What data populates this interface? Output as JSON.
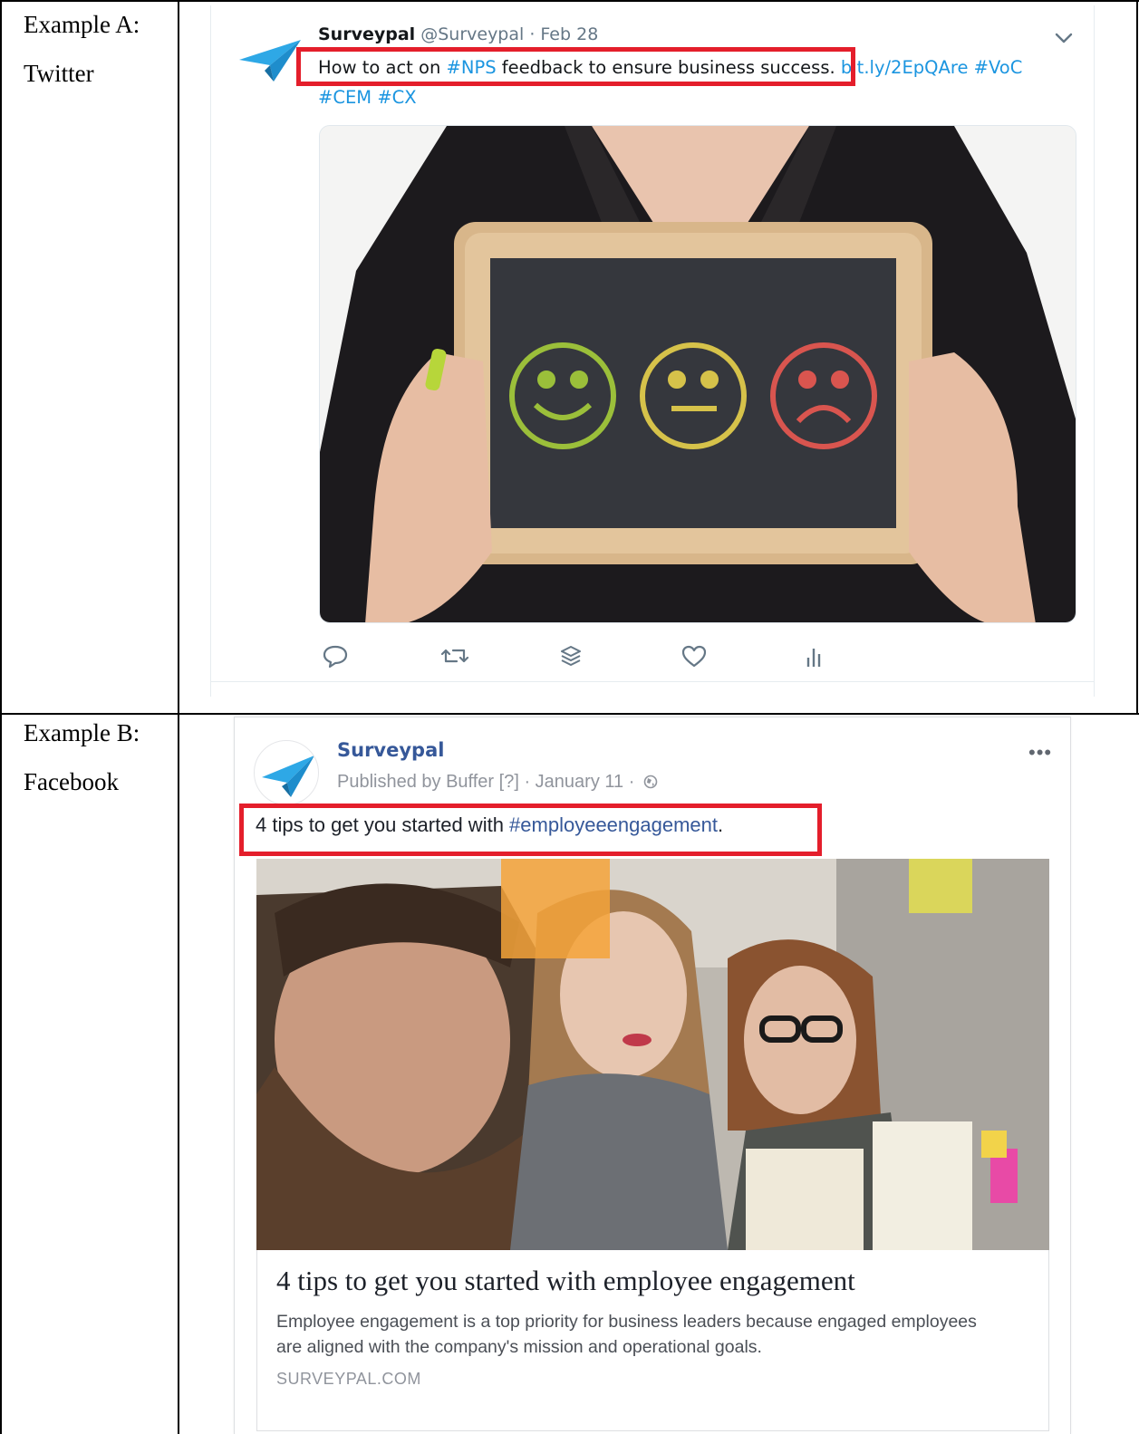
{
  "rows": [
    {
      "label_line1": "Example A:",
      "label_line2": "Twitter"
    },
    {
      "label_line1": "Example B:",
      "label_line2": "Facebook"
    }
  ],
  "twitter": {
    "name": "Surveypal",
    "handle": "@Surveypal",
    "separator": " · ",
    "date": "Feb 28",
    "text_plain_1": "How to act on ",
    "hashtag_nps": "#NPS",
    "text_plain_2": " feedback to ensure business success.",
    "space": " ",
    "link_url": "bit.ly/2EpQAre",
    "hashtag_voc": "#VoC",
    "hashtag_cem": "#CEM",
    "hashtag_cx": "#CX",
    "media_icon_name": "chalkboard-smileys-image",
    "actions": [
      "reply-icon",
      "retweet-icon",
      "stack-icon",
      "like-icon",
      "analytics-icon"
    ]
  },
  "facebook": {
    "page_name": "Surveypal",
    "published_by": "Published by Buffer",
    "help_marker": "[?]",
    "dot": " · ",
    "date": "January 11",
    "more": "•••",
    "text_plain": "4 tips to get you started with ",
    "hashtag": "#employeeengagement",
    "text_end": ".",
    "media_icon_name": "team-photo-image",
    "link_title": "4 tips to get you started with employee engagement",
    "link_description": "Employee engagement is a top priority for business leaders because engaged employees are aligned with the company's mission and operational goals.",
    "link_domain": "SURVEYPAL.COM"
  },
  "colors": {
    "highlight": "#e41e2b",
    "twitter_link": "#1b95e0",
    "facebook_link": "#365899",
    "surveypal_brand": "#2ea8e6"
  }
}
